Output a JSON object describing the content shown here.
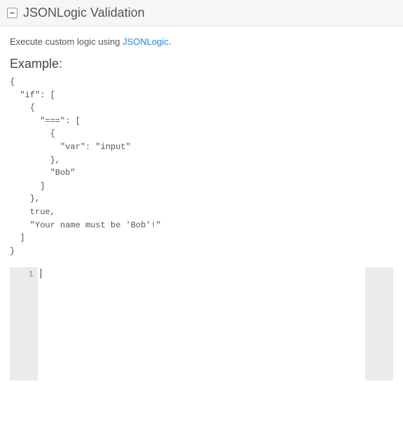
{
  "header": {
    "title": "JSONLogic Validation"
  },
  "body": {
    "intro_prefix": "Execute custom logic using ",
    "intro_link_text": "JSONLogic",
    "intro_suffix": ".",
    "example_heading": "Example:",
    "example_code": "{\n  \"if\": [\n    {\n      \"===\": [\n        {\n          \"var\": \"input\"\n        },\n        \"Bob\"\n      ]\n    },\n    true,\n    \"Your name must be 'Bob'!\"\n  ]\n}"
  },
  "editor": {
    "line_number": "1",
    "content": ""
  }
}
